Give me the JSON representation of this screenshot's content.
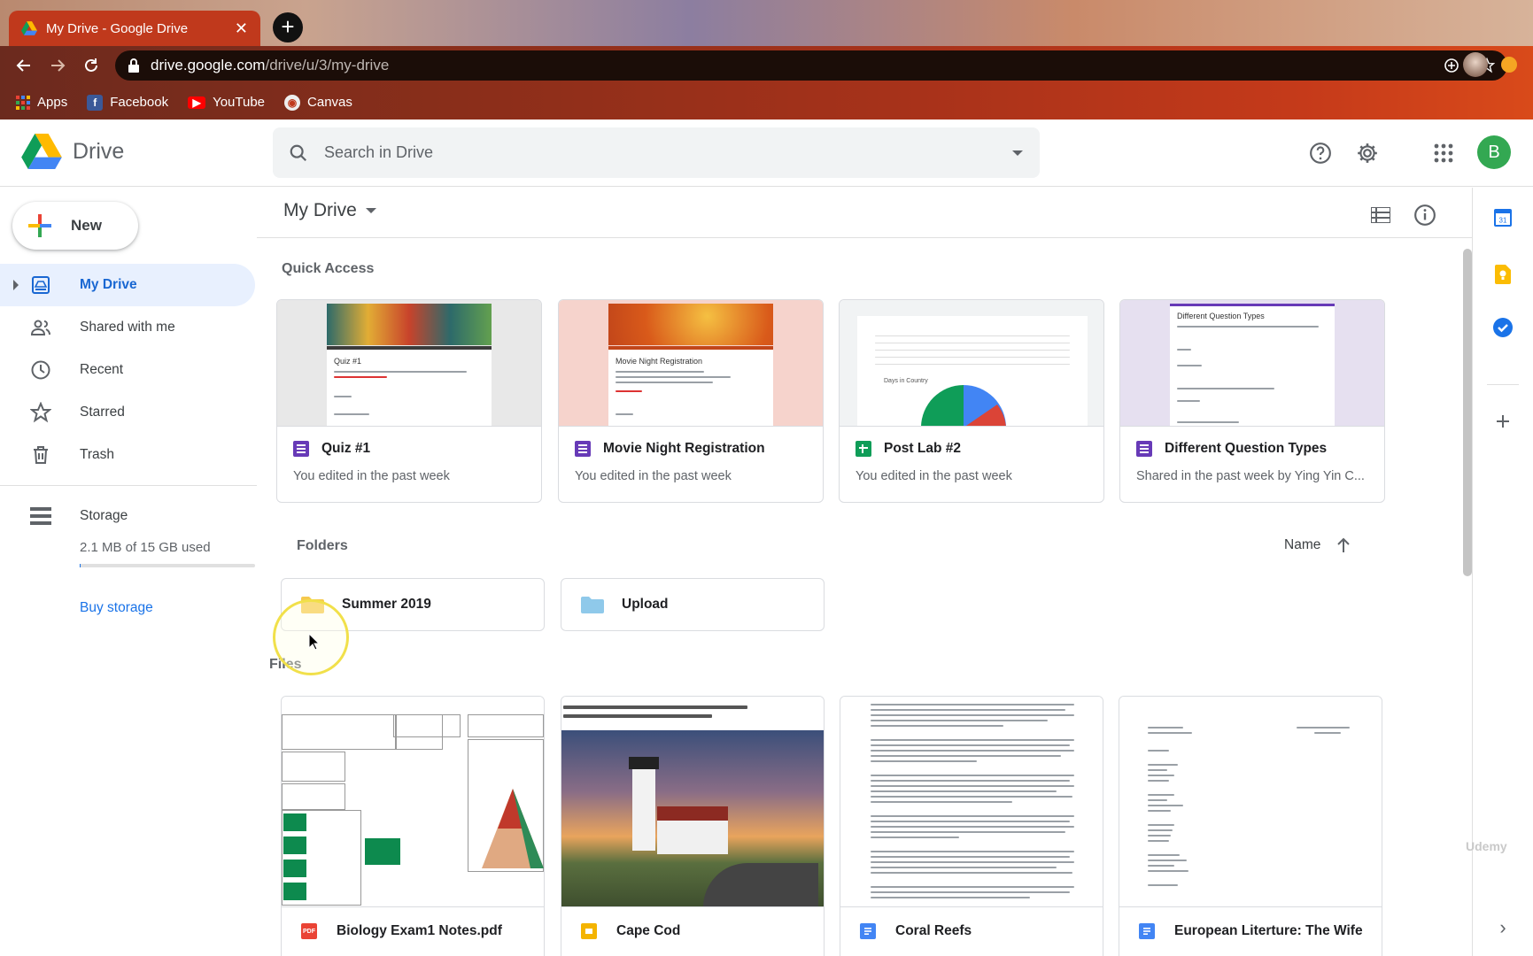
{
  "browser": {
    "tab_title": "My Drive - Google Drive",
    "close_glyph": "✕",
    "new_tab_glyph": "+",
    "url_host": "drive.google.com",
    "url_path": "/drive/u/3/my-drive",
    "bookmarks": [
      "Apps",
      "Facebook",
      "YouTube",
      "Canvas"
    ]
  },
  "drive": {
    "product_name": "Drive",
    "search_placeholder": "Search in Drive",
    "avatar_letter": "B"
  },
  "sidebar": {
    "new_label": "New",
    "items": [
      {
        "label": "My Drive",
        "icon": "my-drive-icon"
      },
      {
        "label": "Shared with me",
        "icon": "shared-icon"
      },
      {
        "label": "Recent",
        "icon": "clock-icon"
      },
      {
        "label": "Starred",
        "icon": "star-icon"
      },
      {
        "label": "Trash",
        "icon": "trash-icon"
      }
    ],
    "storage_label": "Storage",
    "storage_used": "2.1 MB of 15 GB used",
    "storage_fraction": 0.00014,
    "buy_storage": "Buy storage"
  },
  "main": {
    "title": "My Drive",
    "quick_access_label": "Quick Access",
    "quick_access": [
      {
        "name": "Quiz #1",
        "subtitle": "You edited in the past week",
        "type": "form",
        "thumb_heading": "Quiz #1"
      },
      {
        "name": "Movie Night Registration",
        "subtitle": "You edited in the past week",
        "type": "form",
        "thumb_heading": "Movie Night Registration"
      },
      {
        "name": "Post Lab #2",
        "subtitle": "You edited in the past week",
        "type": "sheet",
        "thumb_heading": "Days in Country"
      },
      {
        "name": "Different Question Types",
        "subtitle": "Shared in the past week by Ying Yin C...",
        "type": "form",
        "thumb_heading": "Different Question Types"
      }
    ],
    "folders_label": "Folders",
    "sort_label": "Name",
    "folders": [
      {
        "name": "Summer 2019",
        "color": "#f6c94e"
      },
      {
        "name": "Upload",
        "color": "#8fc9ea"
      }
    ],
    "files_label": "Files",
    "files": [
      {
        "name": "Biology Exam1 Notes.pdf",
        "type": "pdf"
      },
      {
        "name": "Cape Cod",
        "type": "slides"
      },
      {
        "name": "Coral Reefs",
        "type": "doc"
      },
      {
        "name": "European Literture: The Wife",
        "type": "doc"
      }
    ]
  },
  "rail": {
    "calendar_day": "31",
    "expand_glyph": "›"
  },
  "watermark": "Udemy",
  "colors": {
    "accent_blue": "#1a73e8",
    "form_purple": "#673ab7",
    "sheet_green": "#0f9d58",
    "pdf_red": "#ea4335",
    "slides_yellow": "#f4b400",
    "doc_blue": "#4285f4"
  }
}
